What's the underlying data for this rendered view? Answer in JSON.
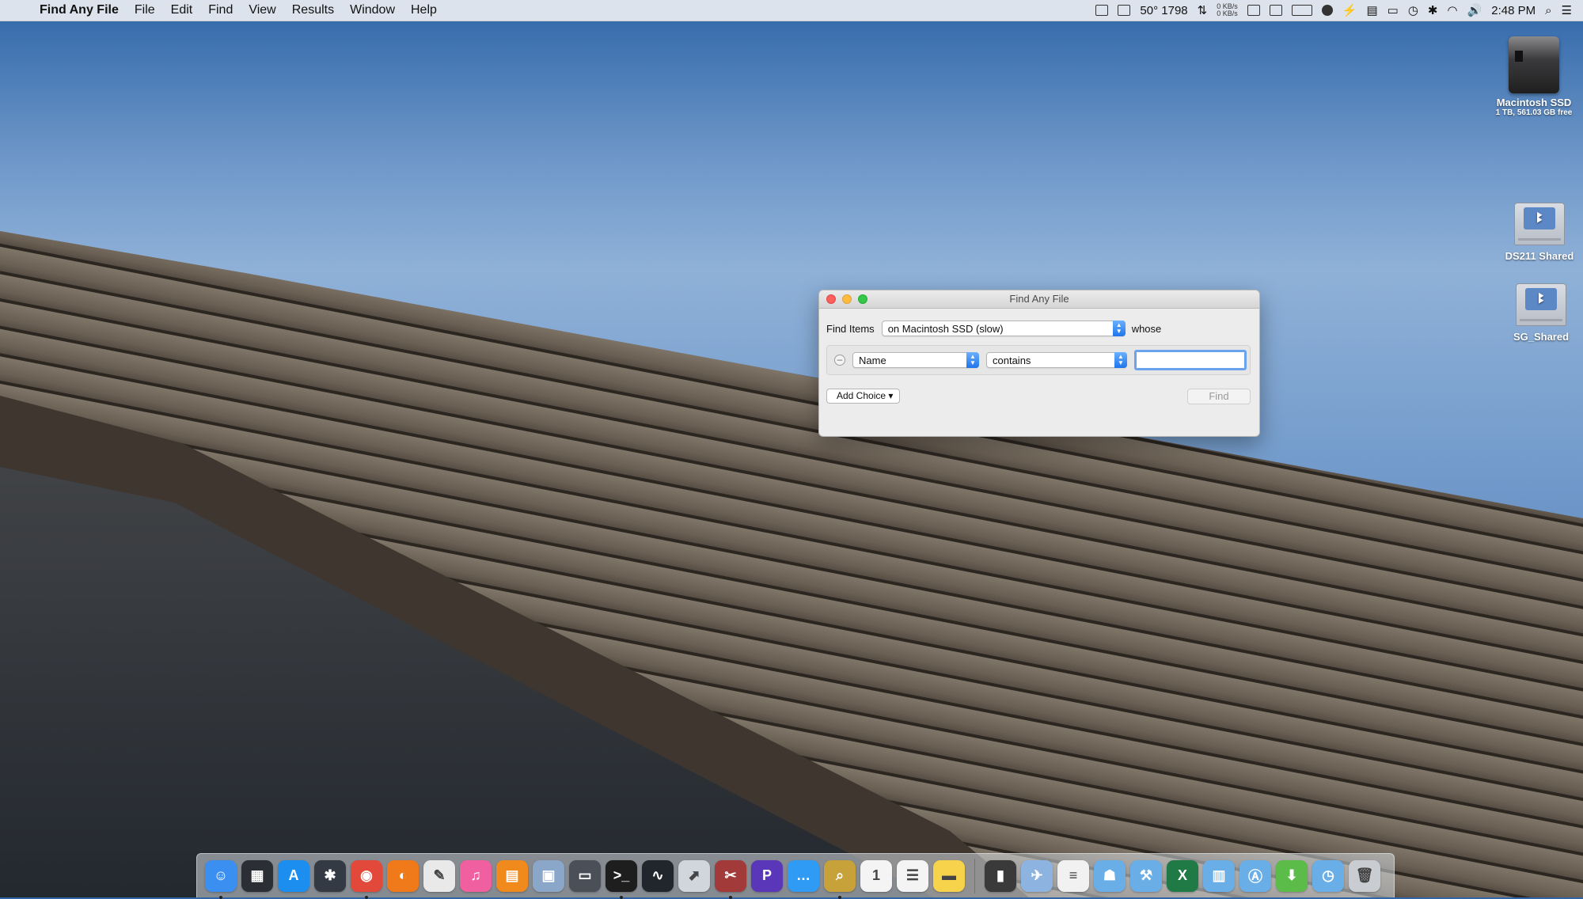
{
  "menubar": {
    "apple": "",
    "app_name": "Find Any File",
    "menus": [
      "File",
      "Edit",
      "Find",
      "View",
      "Results",
      "Window",
      "Help"
    ],
    "status_text": "50° 1798",
    "net_up": "0 KB/s",
    "net_down": "0 KB/s",
    "clock": "2:48 PM"
  },
  "desktop": {
    "macintosh_ssd": {
      "name": "Macintosh SSD",
      "info": "1 TB, 561.03 GB free"
    },
    "ds211": {
      "name": "DS211 Shared"
    },
    "sg_shared": {
      "name": "SG_Shared"
    }
  },
  "window": {
    "title": "Find Any File",
    "find_items_label": "Find Items",
    "location_value": "on Macintosh SSD (slow)",
    "whose_label": "whose",
    "criteria": {
      "attribute_value": "Name",
      "operator_value": "contains",
      "search_value": ""
    },
    "add_choice_label": "Add Choice ▾",
    "find_label": "Find"
  },
  "dock": {
    "items": [
      {
        "name": "finder-icon",
        "glyph": "☺",
        "color": "#3b8ff0",
        "running": true
      },
      {
        "name": "mission-control-icon",
        "glyph": "▦",
        "color": "#2b2f35",
        "running": false
      },
      {
        "name": "app-store-icon",
        "glyph": "A",
        "color": "#1c8ef0",
        "running": false
      },
      {
        "name": "launchpad-icon",
        "glyph": "✱",
        "color": "#333a44",
        "running": false
      },
      {
        "name": "chrome-icon",
        "glyph": "◉",
        "color": "#e3493a",
        "running": true
      },
      {
        "name": "firefox-icon",
        "glyph": "◐",
        "color": "#f07a1a",
        "running": false
      },
      {
        "name": "textedit-icon",
        "glyph": "✎",
        "color": "#e9e9e9",
        "running": false
      },
      {
        "name": "itunes-icon",
        "glyph": "♫",
        "color": "#f05fa0",
        "running": false
      },
      {
        "name": "books-icon",
        "glyph": "▤",
        "color": "#f08a1c",
        "running": false
      },
      {
        "name": "preview-icon",
        "glyph": "▣",
        "color": "#8aa6c8",
        "running": false
      },
      {
        "name": "system-info-icon",
        "glyph": "▭",
        "color": "#4a4f58",
        "running": false
      },
      {
        "name": "terminal-icon",
        "glyph": ">_",
        "color": "#1e1e1e",
        "running": true
      },
      {
        "name": "activity-monitor-icon",
        "glyph": "∿",
        "color": "#20262b",
        "running": false
      },
      {
        "name": "migration-icon",
        "glyph": "⬈",
        "color": "#d1d6dc",
        "running": false
      },
      {
        "name": "utility-icon",
        "glyph": "✂",
        "color": "#a33a3a",
        "running": true
      },
      {
        "name": "p-app-icon",
        "glyph": "P",
        "color": "#5a37b8",
        "running": false
      },
      {
        "name": "messages-icon",
        "glyph": "…",
        "color": "#2f9bf5",
        "running": false
      },
      {
        "name": "find-any-file-icon",
        "glyph": "⌕",
        "color": "#c7a23a",
        "running": true
      },
      {
        "name": "calendar-icon",
        "glyph": "1",
        "color": "#f4f4f4",
        "running": false
      },
      {
        "name": "reminders-icon",
        "glyph": "☰",
        "color": "#f4f4f4",
        "running": false
      },
      {
        "name": "notes-icon",
        "glyph": "▬",
        "color": "#f6d34a",
        "running": false
      },
      {
        "name": "separator",
        "glyph": "",
        "color": "",
        "running": false
      },
      {
        "name": "document-icon",
        "glyph": "▮",
        "color": "#3a3a3a",
        "running": false
      },
      {
        "name": "photo-folder-icon",
        "glyph": "✈",
        "color": "#8db4e0",
        "running": false
      },
      {
        "name": "text-file-icon",
        "glyph": "≡",
        "color": "#f1f1f1",
        "running": false
      },
      {
        "name": "users-folder-icon",
        "glyph": "☗",
        "color": "#6aaee8",
        "running": false
      },
      {
        "name": "utilities-folder-icon",
        "glyph": "⚒",
        "color": "#6aaee8",
        "running": false
      },
      {
        "name": "excel-icon",
        "glyph": "X",
        "color": "#1f7a45",
        "running": false
      },
      {
        "name": "documents-folder-icon",
        "glyph": "▥",
        "color": "#6aaee8",
        "running": false
      },
      {
        "name": "applications-folder-icon",
        "glyph": "Ⓐ",
        "color": "#6aaee8",
        "running": false
      },
      {
        "name": "downloads-icon",
        "glyph": "⬇",
        "color": "#5cbc4a",
        "running": false
      },
      {
        "name": "shared-folder-icon",
        "glyph": "◷",
        "color": "#6aaee8",
        "running": false
      },
      {
        "name": "trash-icon",
        "glyph": "🗑",
        "color": "#c9ccd1",
        "running": false
      }
    ]
  }
}
